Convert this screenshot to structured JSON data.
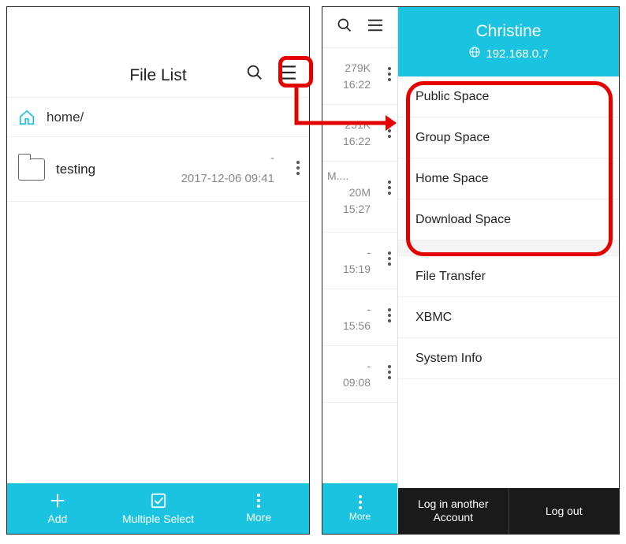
{
  "left": {
    "title": "File List",
    "breadcrumb": "home/",
    "item": {
      "name": "testing",
      "size": "-",
      "date": "2017-12-06 09:41"
    },
    "bottom": {
      "add": "Add",
      "multiple": "Multiple Select",
      "more": "More"
    }
  },
  "right": {
    "strip_rows": [
      {
        "size": "279K",
        "time": "16:22"
      },
      {
        "size": "251K",
        "time": "16:22"
      },
      {
        "name": "M....",
        "size": "20M",
        "time": "15:27"
      },
      {
        "size": "-",
        "time": "15:19"
      },
      {
        "size": "-",
        "time": "15:56"
      },
      {
        "size": "-",
        "time": "09:08"
      }
    ],
    "strip_more": "More",
    "drawer": {
      "user": "Christine",
      "ip": "192.168.0.7",
      "spaces": [
        "Public Space",
        "Group Space",
        "Home Space",
        "Download Space"
      ],
      "tools": [
        "File Transfer",
        "XBMC",
        "System Info"
      ],
      "footer": {
        "switch": "Log in another Account",
        "logout": "Log out"
      }
    }
  }
}
